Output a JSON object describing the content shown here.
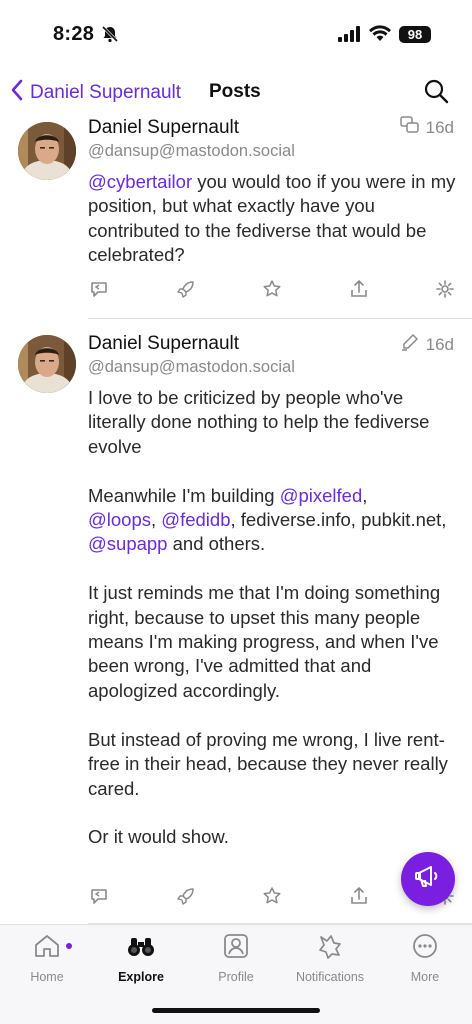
{
  "status_bar": {
    "time": "8:28",
    "battery": "98"
  },
  "nav": {
    "back_label": "Daniel Supernault",
    "title": "Posts"
  },
  "posts": [
    {
      "author": "Daniel Supernault",
      "handle": "@dansup@mastodon.social",
      "time": "16d",
      "meta_icon": "quote-icon",
      "content_parts": [
        {
          "text": "@cybertailor",
          "mention": true
        },
        {
          "text": " you would too if you were in my position, but what exactly have you contributed to the fediverse that would be celebrated?",
          "mention": false
        }
      ]
    },
    {
      "author": "Daniel Supernault",
      "handle": "@dansup@mastodon.social",
      "time": "16d",
      "meta_icon": "pencil-icon",
      "content_parts": [
        {
          "text": "I love to be criticized by people who've literally done nothing to help the fediverse evolve\n\nMeanwhile I'm building ",
          "mention": false
        },
        {
          "text": "@pixelfed",
          "mention": true
        },
        {
          "text": ",\n",
          "mention": false
        },
        {
          "text": "@loops",
          "mention": true
        },
        {
          "text": ", ",
          "mention": false
        },
        {
          "text": "@fedidb",
          "mention": true
        },
        {
          "text": ", fediverse.info, pubkit.net, ",
          "mention": false
        },
        {
          "text": "@supapp",
          "mention": true
        },
        {
          "text": " and others.\n\nIt just reminds me that I'm doing something right, because to upset this many people means I'm making progress, and when I've been wrong, I've admitted that and apologized accordingly.\n\nBut instead of proving me wrong, I live rent-free in their head, because they never really cared.\n\nOr it would show.",
          "mention": false
        }
      ]
    }
  ],
  "tabs": [
    {
      "label": "Home",
      "icon": "home-icon",
      "active": false
    },
    {
      "label": "Explore",
      "icon": "binoculars-icon",
      "active": true
    },
    {
      "label": "Profile",
      "icon": "profile-icon",
      "active": false
    },
    {
      "label": "Notifications",
      "icon": "notifications-icon",
      "active": false
    },
    {
      "label": "More",
      "icon": "more-icon",
      "active": false
    }
  ],
  "colors": {
    "accent": "#6a2bd9",
    "fab": "#7a1fe0",
    "muted": "#8a8a8e"
  }
}
